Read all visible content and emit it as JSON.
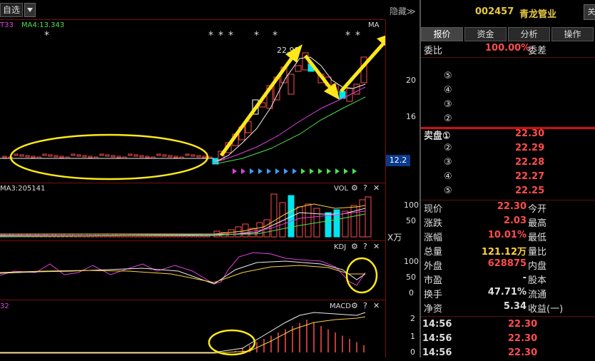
{
  "toolbar": {
    "watchlist_label": "自选",
    "hide_label": "隐藏≫"
  },
  "panel1": {
    "indicator_left": "T33",
    "ma4_label": "MA4:13.343",
    "ma_label": "MA",
    "peak_label": "22.98",
    "y_ticks": [
      "20",
      "16",
      "12.2"
    ],
    "current_price_tag": "12.2"
  },
  "panel2": {
    "ma3_label": "MA3:205141",
    "name": "VOL",
    "y_ticks": [
      "100",
      "50"
    ],
    "unit": "X万"
  },
  "panel3": {
    "name": "KDJ",
    "y_ticks": [
      "100",
      "50",
      "0"
    ]
  },
  "panel4": {
    "left_label": "32",
    "name": "MACD",
    "y_ticks": [
      "2",
      "1",
      "0"
    ]
  },
  "icons": {
    "gear": "⚙",
    "help": "?",
    "close": "✕"
  },
  "quote": {
    "code": "002457",
    "name": "青龙管业",
    "corner_btn": "关",
    "tabs": [
      "报价",
      "资金",
      "分析",
      "操作"
    ],
    "weibi_label": "委比",
    "weibi_value": "100.00%",
    "weicha_label": "委差",
    "sell_rows": [
      {
        "label": "⑤"
      },
      {
        "label": "④"
      },
      {
        "label": "③"
      },
      {
        "label": "②"
      },
      {
        "label": "卖盘①"
      }
    ],
    "buy_rows": [
      {
        "label": "买盘①",
        "price": "22.30"
      },
      {
        "label": "②",
        "price": "22.29"
      },
      {
        "label": "③",
        "price": "22.28"
      },
      {
        "label": "④",
        "price": "22.27"
      },
      {
        "label": "⑤",
        "price": "22.25"
      }
    ],
    "stats": [
      {
        "l1": "现价",
        "v1": "22.30",
        "l2": "今开",
        "c": "red"
      },
      {
        "l1": "涨跌",
        "v1": "2.03",
        "l2": "最高",
        "c": "red"
      },
      {
        "l1": "涨幅",
        "v1": "10.01%",
        "l2": "最低",
        "c": "red"
      },
      {
        "l1": "总量",
        "v1": "121.12万",
        "l2": "量比",
        "c": "yellow"
      },
      {
        "l1": "外盘",
        "v1": "628875",
        "l2": "内盘",
        "c": "red"
      },
      {
        "l1": "市盈",
        "v1": "-",
        "l2": "股本",
        "c": "white"
      },
      {
        "l1": "换手",
        "v1": "47.71%",
        "l2": "流通",
        "c": "white"
      },
      {
        "l1": "净资",
        "v1": "5.34",
        "l2": "收益(一)",
        "c": "white"
      }
    ],
    "ticks": [
      {
        "time": "14:56",
        "price": "22.30"
      },
      {
        "time": "14:56",
        "price": "22.30"
      },
      {
        "time": "14:56",
        "price": "22.30"
      }
    ]
  },
  "colors": {
    "up": "#ff4d4d",
    "down": "#00e5ee",
    "accent": "#ffd23a",
    "grid": "#7a1010"
  }
}
